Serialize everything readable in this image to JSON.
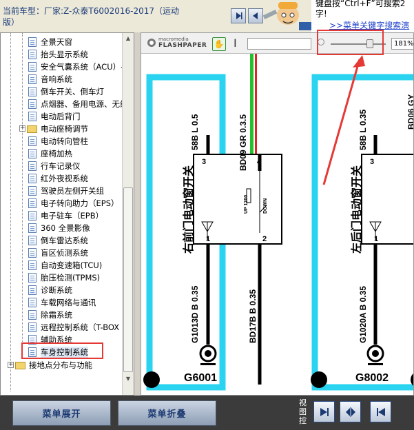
{
  "header": {
    "car_title": "当前车型：厂家:Z-众泰T6002016-2017（运动版）",
    "tip_line1": "键盘按“Ctrl+F”可搜索2",
    "tip_line2": "字!",
    "tip_link": ">>菜单关键字搜索演"
  },
  "tree": {
    "items": [
      "全景天窗",
      "抬头显示系统",
      "安全气囊系统（ACU）-",
      "音响系统",
      "倒车开关、倒车灯",
      "点烟器、备用电源、无线",
      "电动后背门",
      "电动座椅调节",
      "电动转向管柱",
      "座椅加热",
      "行车记录仪",
      "红外夜视系统",
      "驾驶员左侧开关组",
      "电子转向助力（EPS）",
      "电子驻车（EPB）",
      "360 全景影像",
      "倒车雷达系统",
      "盲区侦测系统",
      "自动变速箱(TCU)",
      "胎压检测(TPMS)",
      "诊断系统",
      "车载网络与通讯",
      "除霜系统",
      "远程控制系统（T-BOX",
      "辅助系统",
      "车身控制系统"
    ],
    "bottom_folder": "接地点分布与功能"
  },
  "viewer": {
    "logo_top": "macromedia",
    "logo_bottom": "FLASHPAPER",
    "zoom": "181%",
    "diagram": {
      "left_switch_label": "右前门电动窗开关",
      "right_switch_label": "左后门电动窗开关",
      "wire_58b": "58B L 0.5",
      "wire_bd09": "BD09 GR 0.3.5",
      "wire_58l": "58B L 0.35",
      "wire_bd06": "BD06 GY",
      "wire_g1013d": "G1013D B 0.35",
      "wire_bd17b": "BD17B B 0.35",
      "wire_g1020a": "G1020A B 0.35",
      "pin3": "3",
      "pin4": "4",
      "pin1": "1",
      "pin2": "2",
      "up": "UP 1200",
      "down": "DOWN",
      "ground_left": "G6001",
      "ground_right": "G8002"
    }
  },
  "bottom": {
    "expand": "菜单展开",
    "collapse": "菜单折叠",
    "view_label": "视图控"
  }
}
